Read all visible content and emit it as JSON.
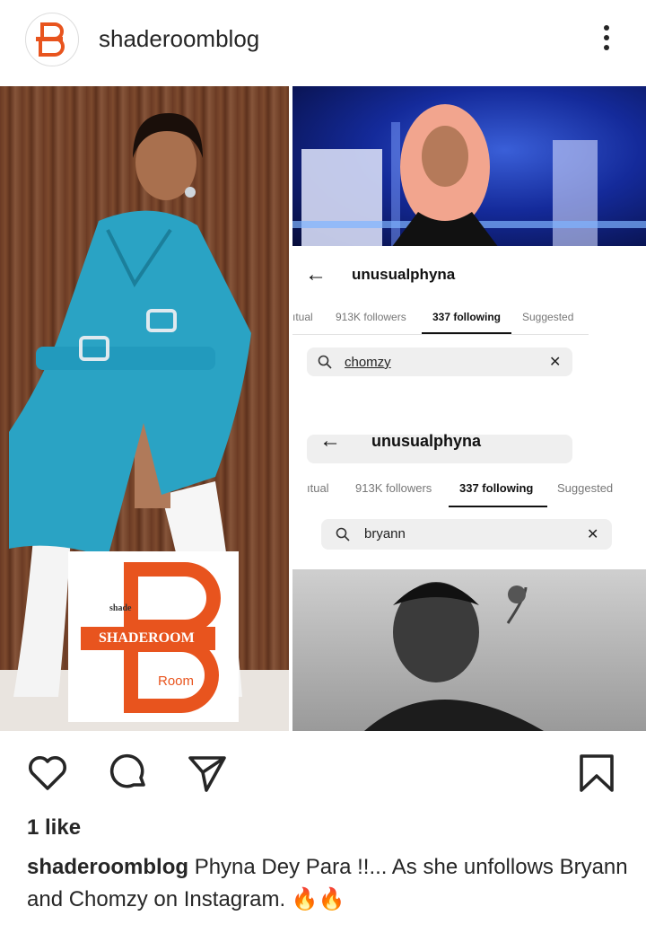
{
  "header": {
    "username": "shaderoomblog",
    "avatar_icon": "shaderoom-logo-icon",
    "more_icon": "more-vertical-icon"
  },
  "post": {
    "screenshot_1": {
      "back_icon": "arrow-left-icon",
      "profile_name": "unusualphyna",
      "tabs": [
        "ıtual",
        "913K followers",
        "337 following",
        "Suggested"
      ],
      "active_tab": "337 following",
      "search_value": "chomzy",
      "clear_icon": "close-icon"
    },
    "screenshot_2": {
      "back_icon": "arrow-left-icon",
      "profile_name": "unusualphyna",
      "tabs": [
        "ıtual",
        "913K followers",
        "337 following",
        "Suggested"
      ],
      "active_tab": "337 following",
      "search_value": "bryann",
      "clear_icon": "close-icon"
    },
    "watermark": {
      "small_text": "shade",
      "banner_text": "SHADEROOM",
      "bottom_text": "Room",
      "color": "#e8541e"
    }
  },
  "actions": {
    "like_icon": "heart-icon",
    "comment_icon": "comment-icon",
    "share_icon": "send-icon",
    "save_icon": "bookmark-icon"
  },
  "likes_text": "1 like",
  "caption": {
    "username": "shaderoomblog",
    "text": "Phyna Dey Para !!... As she unfollows Bryann and Chomzy on Instagram. 🔥🔥"
  },
  "colors": {
    "accent": "#e8541e",
    "text": "#262626"
  }
}
